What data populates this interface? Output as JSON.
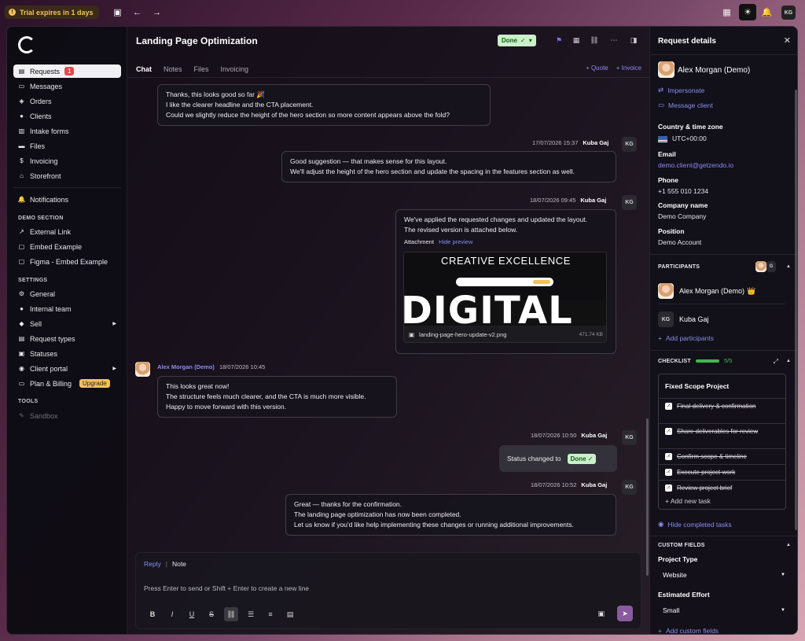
{
  "topbar": {
    "trial_text": "Trial expires in 1 days",
    "user_initials": "KG"
  },
  "sidebar": {
    "items": [
      {
        "label": "Requests",
        "icon": "inbox-icon",
        "badge": "1"
      },
      {
        "label": "Messages",
        "icon": "chat-icon"
      },
      {
        "label": "Orders",
        "icon": "box-icon"
      },
      {
        "label": "Clients",
        "icon": "user-icon"
      },
      {
        "label": "Intake forms",
        "icon": "form-icon"
      },
      {
        "label": "Files",
        "icon": "folder-icon"
      },
      {
        "label": "Invoicing",
        "icon": "dollar-icon"
      },
      {
        "label": "Storefront",
        "icon": "store-icon"
      }
    ],
    "notifications": "Notifications",
    "demo_section": "DEMO SECTION",
    "demo_items": [
      "External Link",
      "Embed Example",
      "Figma - Embed Example"
    ],
    "settings_section": "SETTINGS",
    "settings_items": [
      "General",
      "Internal team",
      "Sell",
      "Request types",
      "Statuses",
      "Client portal",
      "Plan & Billing"
    ],
    "upgrade_badge": "Upgrade",
    "tools_section": "TOOLS",
    "tools_items": [
      "Sandbox"
    ]
  },
  "main": {
    "title": "Landing Page Optimization",
    "status": "Done",
    "tabs": [
      "Chat",
      "Notes",
      "Files",
      "Invoicing"
    ],
    "actions": [
      "+ Quote",
      "+ Invoice"
    ],
    "messages": [
      {
        "lines": [
          "Thanks, this looks good so far 🎉",
          "I like the clearer headline and the CTA placement.",
          "Could we slightly reduce the height of the hero section so more content appears above the fold?"
        ]
      },
      {
        "time": "17/07/2026 15:37",
        "author": "Kuba Gaj",
        "initials": "KG",
        "lines": [
          "Good suggestion — that makes sense for this layout.",
          "We'll adjust the height of the hero section and update the spacing in the features section as well."
        ]
      },
      {
        "time": "18/07/2026 09:45",
        "author": "Kuba Gaj",
        "initials": "KG",
        "lines": [
          "We've applied the requested changes and updated the layout.",
          "The revised version is attached below."
        ],
        "attachment_label": "Attachment",
        "hide_preview": "Hide preview",
        "preview_heading": "CREATIVE EXCELLENCE",
        "preview_big": "DIGITAL",
        "file_name": "landing-page-hero-update-v2.png",
        "file_size": "471.74 KB"
      },
      {
        "author": "Alex Morgan (Demo)",
        "time": "18/07/2026 10:45",
        "lines": [
          "This looks great now!",
          "The structure feels much clearer, and the CTA is much more visible.",
          "Happy to move forward with this version."
        ]
      },
      {
        "time": "18/07/2026 10:50",
        "author": "Kuba Gaj",
        "initials": "KG",
        "status_text": "Status changed to",
        "status_value": "Done"
      },
      {
        "time": "18/07/2026 10:52",
        "author": "Kuba Gaj",
        "initials": "KG",
        "lines": [
          "Great — thanks for the confirmation.",
          "The landing page optimization has now been completed.",
          "Let us know if you'd like help implementing these changes or running additional improvements."
        ]
      }
    ],
    "composer": {
      "reply_tab": "Reply",
      "separator": "|",
      "note_tab": "Note",
      "placeholder": "Press Enter to send or Shift + Enter to create a new line"
    }
  },
  "panel": {
    "title": "Request details",
    "client_name": "Alex Morgan (Demo)",
    "impersonate": "Impersonate",
    "message_client": "Message client",
    "country_label": "Country & time zone",
    "country_value": "UTC+00:00",
    "email_label": "Email",
    "email_value": "demo.client@getzendo.io",
    "phone_label": "Phone",
    "phone_value": "+1 555 010 1234",
    "company_label": "Company name",
    "company_value": "Demo Company",
    "position_label": "Position",
    "position_value": "Demo Account",
    "participants_label": "PARTICIPANTS",
    "participants_extra": "G",
    "participants": [
      {
        "name": "Alex Morgan (Demo)",
        "crown": "👑"
      },
      {
        "name": "Kuba Gaj",
        "initials": "KG"
      }
    ],
    "add_participants": "Add participants",
    "checklist_label": "CHECKLIST",
    "checklist_count": "5/5",
    "checklist_progress": 1.0,
    "checklist_title": "Fixed Scope Project",
    "checklist_items": [
      "Final delivery & confirmation",
      "Share deliverables for review",
      "Confirm scope & timeline",
      "Execute project work",
      "Review project brief"
    ],
    "add_task": "Add new task",
    "hide_completed": "Hide completed tasks",
    "custom_fields_label": "CUSTOM FIELDS",
    "project_type_label": "Project Type",
    "project_type_value": "Website",
    "effort_label": "Estimated Effort",
    "effort_value": "Small",
    "add_custom_fields": "Add custom fields"
  }
}
